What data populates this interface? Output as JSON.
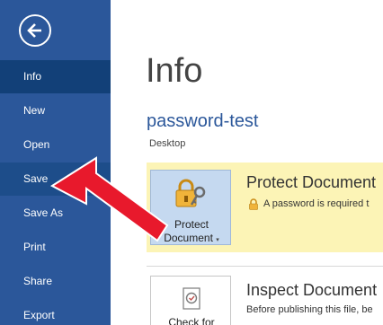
{
  "sidebar": {
    "back_icon": "back-arrow-circle-icon",
    "items": [
      {
        "label": "Info"
      },
      {
        "label": "New"
      },
      {
        "label": "Open"
      },
      {
        "label": "Save"
      },
      {
        "label": "Save As"
      },
      {
        "label": "Print"
      },
      {
        "label": "Share"
      },
      {
        "label": "Export"
      }
    ],
    "selected": "Info",
    "hovered": "Save"
  },
  "main": {
    "title": "Info",
    "document_name": "password-test",
    "document_location": "Desktop",
    "sections": [
      {
        "button_label_line1": "Protect",
        "button_label_line2": "Document",
        "heading": "Protect Document",
        "description": "A password is required t",
        "icon": "lock-key-icon",
        "desc_icon": "padlock-icon",
        "highlight_color": "#fcf4b6"
      },
      {
        "button_label_line1": "Check for",
        "heading": "Inspect Document",
        "description": "Before publishing this file, be",
        "icon": "inspect-document-icon"
      }
    ]
  },
  "annotation": {
    "type": "red-arrow",
    "points_to": "Save",
    "color": "#e8192c"
  },
  "colors": {
    "sidebar": "#2b579a",
    "sidebar_selected": "#124078",
    "accent_text": "#2b579a"
  }
}
